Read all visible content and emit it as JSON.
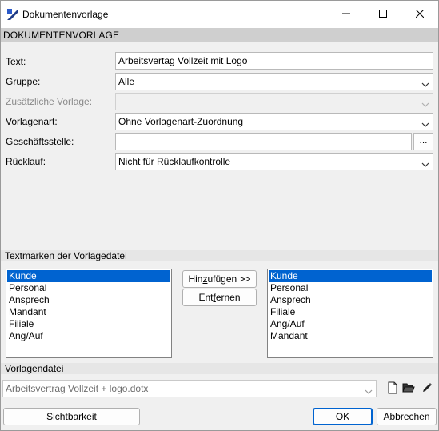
{
  "window": {
    "title": "Dokumentenvorlage"
  },
  "section": {
    "header": "DOKUMENTENVORLAGE"
  },
  "form": {
    "text_label": "Text:",
    "text_value": "Arbeitsvertag Vollzeit mit Logo",
    "gruppe_label": "Gruppe:",
    "gruppe_value": "Alle",
    "zusatz_label": "Zusätzliche Vorlage:",
    "zusatz_value": "",
    "vorlagenart_label": "Vorlagenart:",
    "vorlagenart_value": "Ohne Vorlagenart-Zuordnung",
    "geschaeftsstelle_label": "Geschäftsstelle:",
    "geschaeftsstelle_value": "",
    "geschaeftsstelle_button": "...",
    "ruecklauf_label": "Rücklauf:",
    "ruecklauf_value": "Nicht für Rücklaufkontrolle"
  },
  "textmarken": {
    "title": "Textmarken der Vorlagedatei",
    "left_items": [
      "Kunde",
      "Personal",
      "Ansprech",
      "Mandant",
      "Filiale",
      "Ang/Auf"
    ],
    "right_items": [
      "Kunde",
      "Personal",
      "Ansprech",
      "Filiale",
      "Ang/Auf",
      "Mandant"
    ],
    "left_selected": 0,
    "right_selected": 0,
    "add_pre": "Hin",
    "add_u": "z",
    "add_post": "ufügen >>",
    "remove_pre": "Ent",
    "remove_u": "f",
    "remove_post": "ernen"
  },
  "vorlagendatei": {
    "title": "Vorlagendatei",
    "value": "Arbeitsvertrag Vollzeit + logo.dotx"
  },
  "footer": {
    "sichtbarkeit": "Sichtbarkeit",
    "ok_u": "O",
    "ok_post": "K",
    "cancel_pre": "A",
    "cancel_u": "b",
    "cancel_post": "brechen"
  },
  "colors": {
    "selection": "#0063d0",
    "header_bg": "#cfcfcf"
  }
}
